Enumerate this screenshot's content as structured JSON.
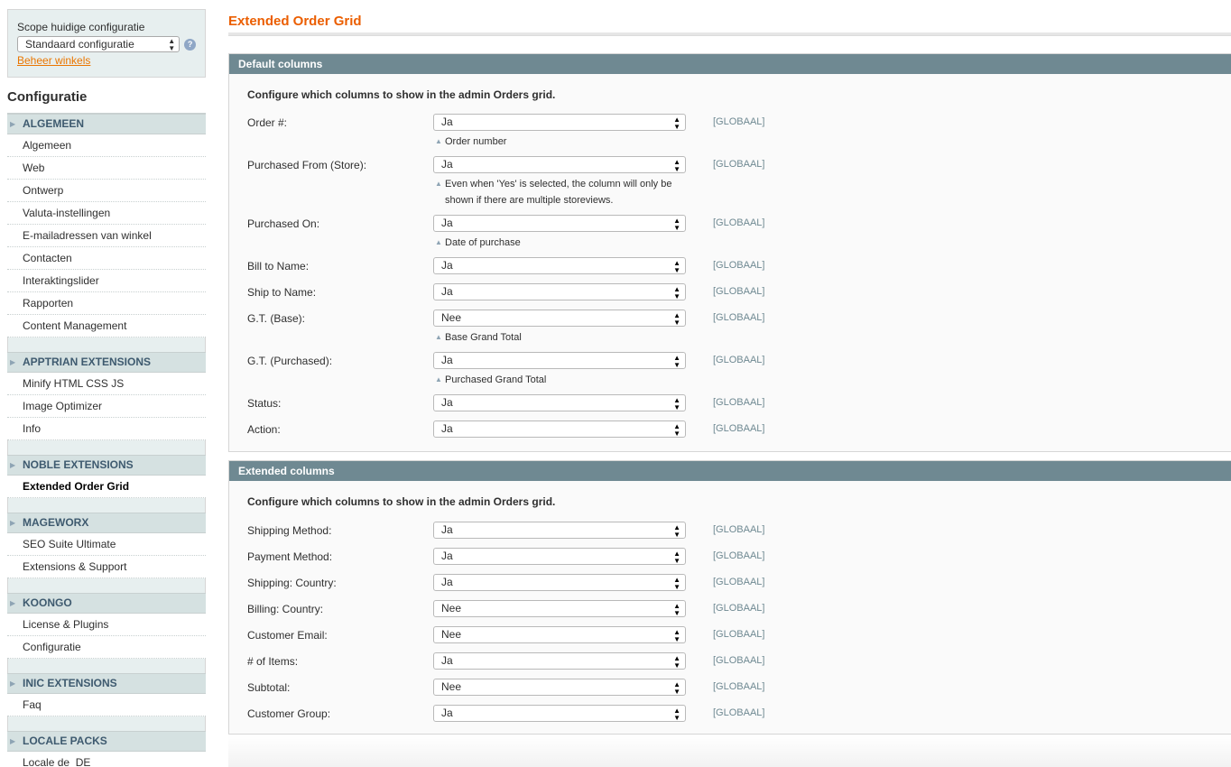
{
  "sidebar": {
    "scope_label": "Scope huidige configuratie",
    "scope_value": "Standaard configuratie",
    "manage_stores_link": "Beheer winkels",
    "config_title": "Configuratie",
    "groups": [
      {
        "title": "ALGEMEEN",
        "items": [
          "Algemeen",
          "Web",
          "Ontwerp",
          "Valuta-instellingen",
          "E-mailadressen van winkel",
          "Contacten",
          "Interaktingslider",
          "Rapporten",
          "Content Management"
        ]
      },
      {
        "title": "APPTRIAN EXTENSIONS",
        "items": [
          "Minify HTML CSS JS",
          "Image Optimizer",
          "Info"
        ]
      },
      {
        "title": "NOBLE EXTENSIONS",
        "items": [
          "Extended Order Grid"
        ]
      },
      {
        "title": "MAGEWORX",
        "items": [
          "SEO Suite Ultimate",
          "Extensions & Support"
        ]
      },
      {
        "title": "KOONGO",
        "items": [
          "License & Plugins",
          "Configuratie"
        ]
      },
      {
        "title": "INIC EXTENSIONS",
        "items": [
          "Faq"
        ]
      },
      {
        "title": "LOCALE PACKS",
        "items": [
          "Locale de_DE"
        ]
      }
    ],
    "active_item": "Extended Order Grid"
  },
  "main": {
    "page_title": "Extended Order Grid",
    "sections": [
      {
        "title": "Default columns",
        "intro": "Configure which columns to show in the admin Orders grid.",
        "rows": [
          {
            "label": "Order #:",
            "value": "Ja",
            "scope": "[GLOBAAL]",
            "note": "Order number"
          },
          {
            "label": "Purchased From (Store):",
            "value": "Ja",
            "scope": "[GLOBAAL]",
            "note": "Even when 'Yes' is selected, the column will only be shown if there are multiple storeviews."
          },
          {
            "label": "Purchased On:",
            "value": "Ja",
            "scope": "[GLOBAAL]",
            "note": "Date of purchase"
          },
          {
            "label": "Bill to Name:",
            "value": "Ja",
            "scope": "[GLOBAAL]"
          },
          {
            "label": "Ship to Name:",
            "value": "Ja",
            "scope": "[GLOBAAL]"
          },
          {
            "label": "G.T. (Base):",
            "value": "Nee",
            "scope": "[GLOBAAL]",
            "note": "Base Grand Total"
          },
          {
            "label": "G.T. (Purchased):",
            "value": "Ja",
            "scope": "[GLOBAAL]",
            "note": "Purchased Grand Total"
          },
          {
            "label": "Status:",
            "value": "Ja",
            "scope": "[GLOBAAL]"
          },
          {
            "label": "Action:",
            "value": "Ja",
            "scope": "[GLOBAAL]"
          }
        ]
      },
      {
        "title": "Extended columns",
        "intro": "Configure which columns to show in the admin Orders grid.",
        "rows": [
          {
            "label": "Shipping Method:",
            "value": "Ja",
            "scope": "[GLOBAAL]"
          },
          {
            "label": "Payment Method:",
            "value": "Ja",
            "scope": "[GLOBAAL]"
          },
          {
            "label": "Shipping: Country:",
            "value": "Ja",
            "scope": "[GLOBAAL]"
          },
          {
            "label": "Billing: Country:",
            "value": "Nee",
            "scope": "[GLOBAAL]"
          },
          {
            "label": "Customer Email:",
            "value": "Nee",
            "scope": "[GLOBAAL]"
          },
          {
            "label": "# of Items:",
            "value": "Ja",
            "scope": "[GLOBAAL]"
          },
          {
            "label": "Subtotal:",
            "value": "Nee",
            "scope": "[GLOBAAL]"
          },
          {
            "label": "Customer Group:",
            "value": "Ja",
            "scope": "[GLOBAAL]"
          }
        ]
      }
    ]
  },
  "colors": {
    "accent": "#eb5e00",
    "section_header": "#6f8992",
    "sidebar_bg": "#e7efef"
  }
}
